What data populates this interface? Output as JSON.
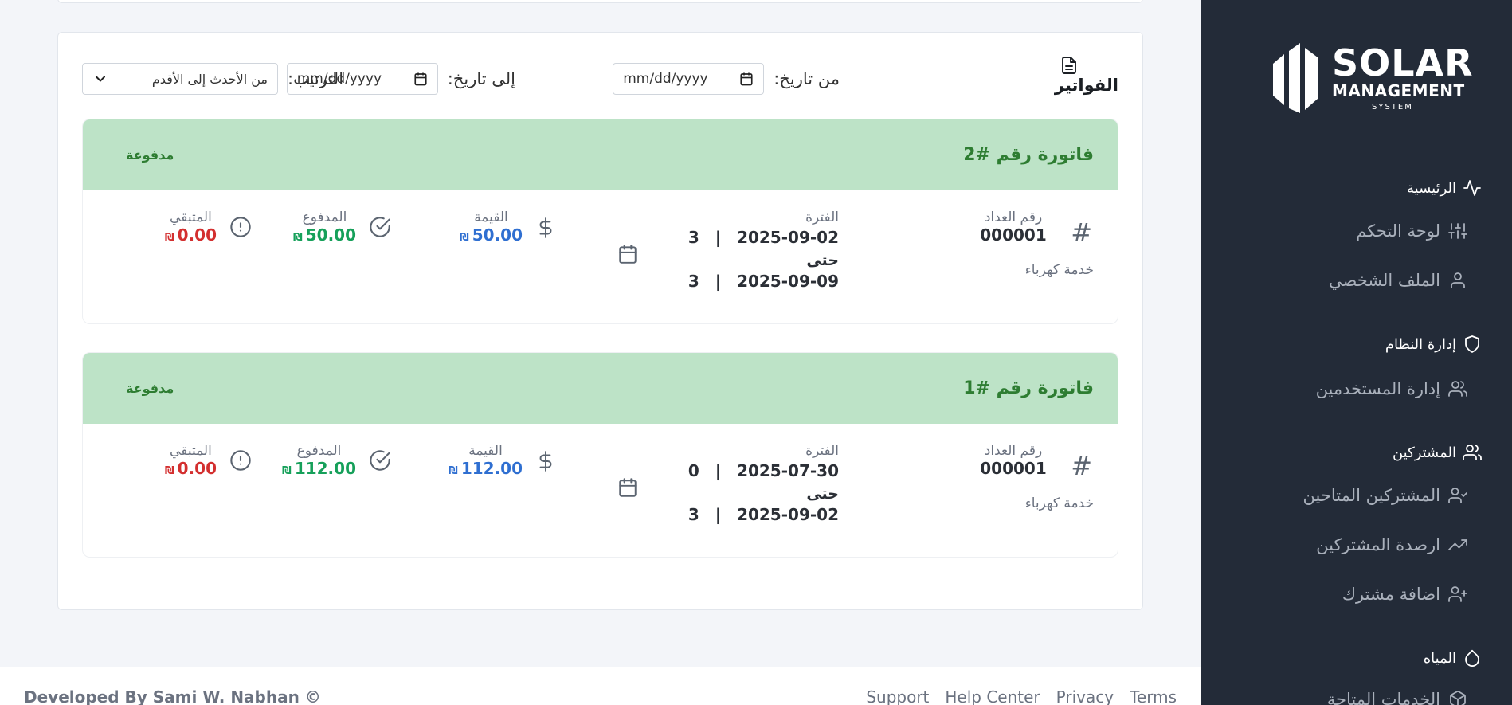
{
  "sidebar": {
    "logo": {
      "line1": "SOLAR",
      "line2": "MANAGEMENT",
      "line3": "SYSTEM"
    },
    "sections": [
      {
        "title": "الرئيسية",
        "icon": "activity-icon"
      },
      {
        "title": "إدارة النظام",
        "icon": "shield-icon"
      },
      {
        "title": "المشتركين",
        "icon": "users-icon"
      },
      {
        "title": "المياه",
        "icon": "droplet-icon"
      }
    ],
    "items": [
      {
        "label": "لوحة التحكم",
        "icon": "sliders-icon"
      },
      {
        "label": "الملف الشخصي",
        "icon": "user-icon"
      },
      {
        "label": "إدارة المستخدمين",
        "icon": "users-icon"
      },
      {
        "label": "المشتركين المتاحين",
        "icon": "user-check-icon"
      },
      {
        "label": "ارصدة المشتركين",
        "icon": "trending-up-icon"
      },
      {
        "label": "اضافة مشترك",
        "icon": "user-plus-icon"
      },
      {
        "label": "الخدمات المتاحة",
        "icon": "box-icon"
      }
    ]
  },
  "header": {
    "title": "الفواتير",
    "from_label": "من تاريخ:",
    "to_label": "إلى تاريخ:",
    "sort_label": "الترتيب:",
    "date_placeholder": "mm/dd/yyyy",
    "sort_value": "من الأحدث إلى الأقدم"
  },
  "labels": {
    "meter": "رقم العداد",
    "period": "الفترة",
    "until": "حتى",
    "value": "القيمة",
    "paid": "المدفوع",
    "remaining": "المتبقي",
    "currency": "₪"
  },
  "invoices": [
    {
      "title": "فاتورة رقم #2",
      "status": "مدفوعة",
      "meter": "000001",
      "service": "خدمة كهرباء",
      "from_date": "2025-09-02",
      "from_reading": "3",
      "to_date": "2025-09-09",
      "to_reading": "3",
      "value": "50.00",
      "paid": "50.00",
      "remaining": "0.00"
    },
    {
      "title": "فاتورة رقم #1",
      "status": "مدفوعة",
      "meter": "000001",
      "service": "خدمة كهرباء",
      "from_date": "2025-07-30",
      "from_reading": "0",
      "to_date": "2025-09-02",
      "to_reading": "3",
      "value": "112.00",
      "paid": "112.00",
      "remaining": "0.00"
    }
  ],
  "footer": {
    "credit": "Developed By Sami W. Nabhan ©",
    "links": [
      "Support",
      "Help Center",
      "Privacy",
      "Terms"
    ]
  }
}
